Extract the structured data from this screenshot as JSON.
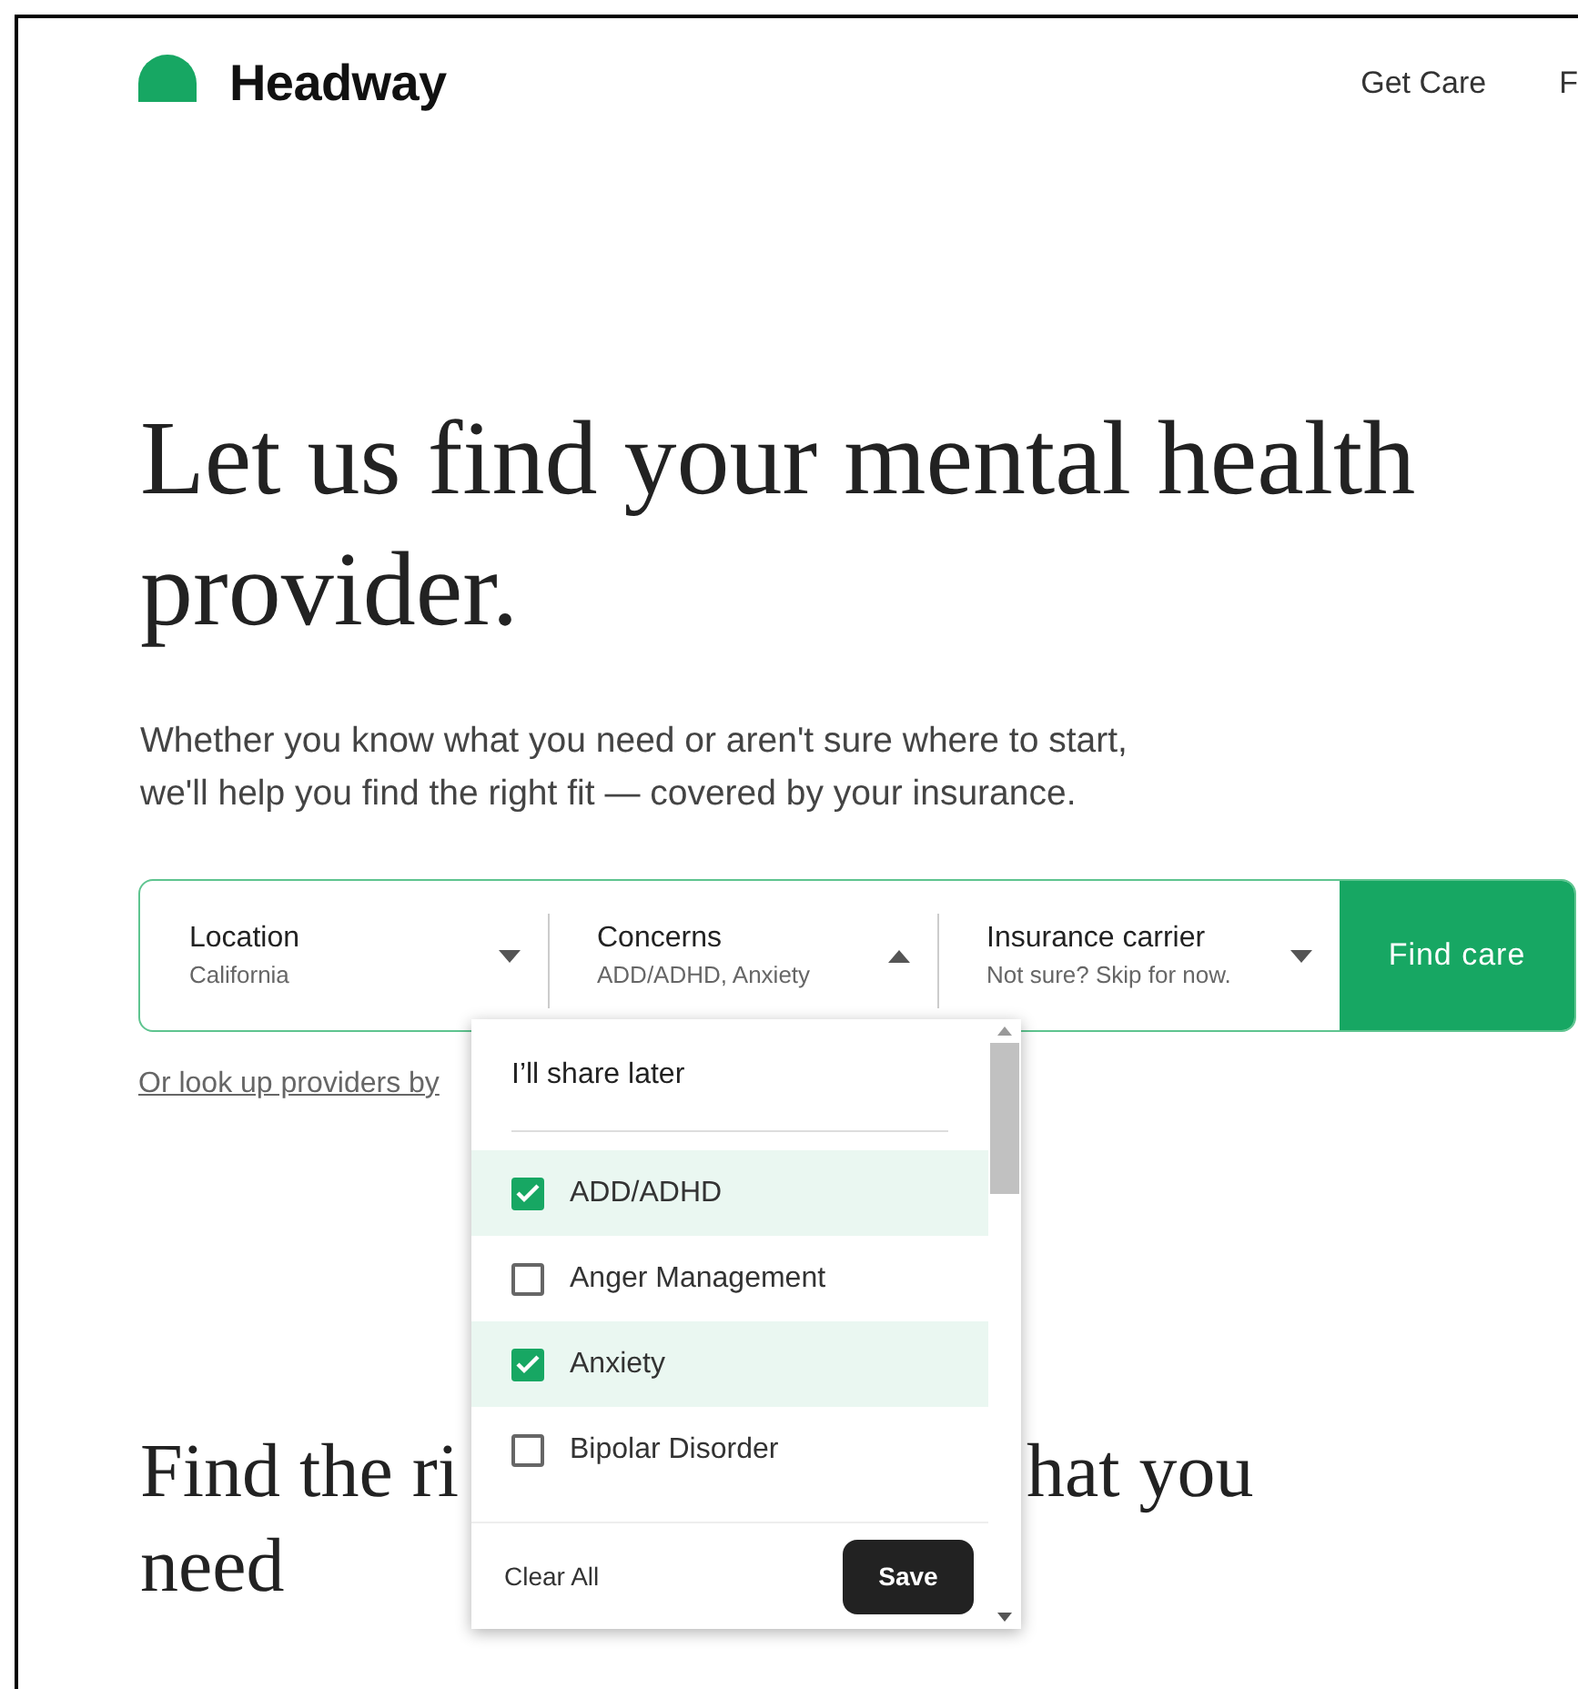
{
  "header": {
    "brand": "Headway",
    "nav": [
      "Get Care",
      "F"
    ]
  },
  "hero": {
    "title": "Let us find your mental health provider.",
    "subtitle": "Whether you know what you need or aren't sure where to start, we'll help you find the right fit — covered by your insurance."
  },
  "search": {
    "fields": [
      {
        "label": "Location",
        "value": "California",
        "expanded": false
      },
      {
        "label": "Concerns",
        "value": "ADD/ADHD, Anxiety",
        "expanded": true
      },
      {
        "label": "Insurance carrier",
        "value": "Not sure? Skip for now.",
        "expanded": false
      }
    ],
    "button": "Find care"
  },
  "lookup_link": "Or look up providers by",
  "dropdown": {
    "top_option": "I’ll share later",
    "options": [
      {
        "label": "ADD/ADHD",
        "checked": true
      },
      {
        "label": "Anger Management",
        "checked": false
      },
      {
        "label": "Anxiety",
        "checked": true
      },
      {
        "label": "Bipolar Disorder",
        "checked": false
      }
    ],
    "clear": "Clear All",
    "save": "Save"
  },
  "section": {
    "heading_start": "Find the ri",
    "heading_end": "hat you",
    "heading_line2": "need"
  }
}
